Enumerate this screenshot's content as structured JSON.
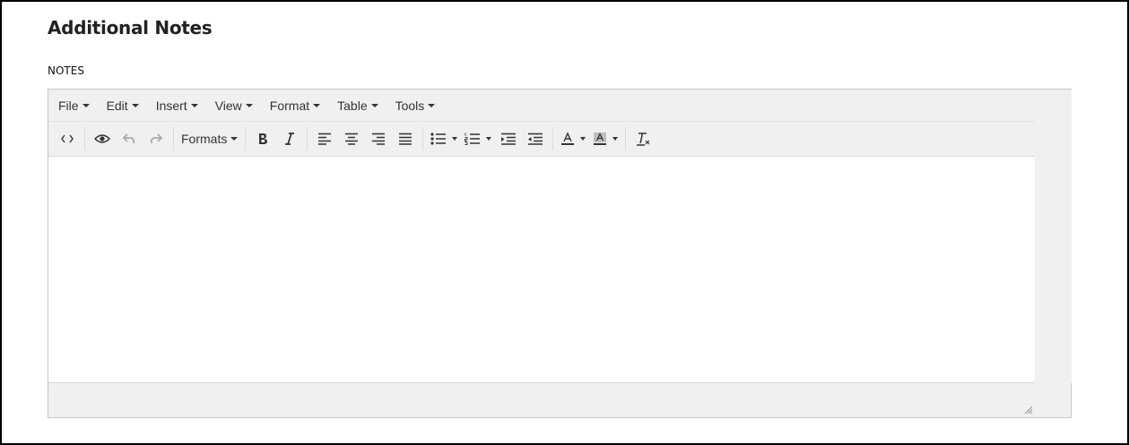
{
  "section": {
    "title": "Additional Notes"
  },
  "field": {
    "label": "NOTES"
  },
  "editor": {
    "menubar": [
      {
        "label": "File"
      },
      {
        "label": "Edit"
      },
      {
        "label": "Insert"
      },
      {
        "label": "View"
      },
      {
        "label": "Format"
      },
      {
        "label": "Table"
      },
      {
        "label": "Tools"
      }
    ],
    "toolbar": {
      "formats_label": "Formats",
      "buttons": [
        "source-code-icon",
        "preview-icon",
        "undo-icon",
        "redo-icon",
        "formats-dropdown",
        "bold-icon",
        "italic-icon",
        "align-left-icon",
        "align-center-icon",
        "align-right-icon",
        "align-justify-icon",
        "bullet-list-icon",
        "numbered-list-icon",
        "outdent-icon",
        "indent-icon",
        "text-color-icon",
        "background-color-icon",
        "clear-formatting-icon"
      ]
    },
    "content": ""
  },
  "colors": {
    "toolbar_bg": "#f0f0f0",
    "icon": "#333333",
    "disabled_icon": "#a8a8a8"
  }
}
